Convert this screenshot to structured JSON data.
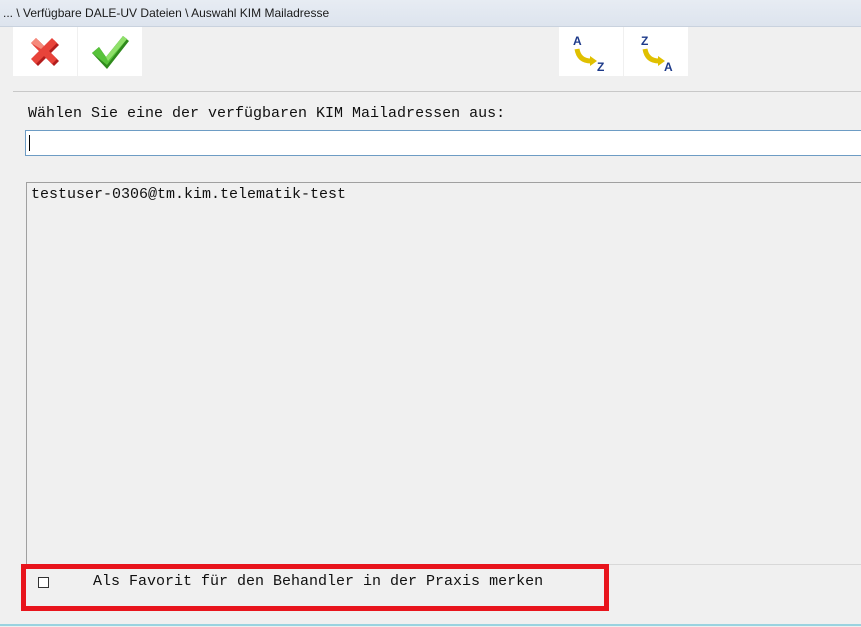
{
  "window": {
    "title": "... \\ Verfügbare DALE-UV Dateien \\ Auswahl KIM Mailadresse"
  },
  "toolbar": {
    "cancel": {
      "icon": "red-x-icon"
    },
    "ok": {
      "icon": "green-check-icon"
    },
    "sort_az": {
      "icon": "sort-a-z-icon",
      "from": "A",
      "to": "Z"
    },
    "sort_za": {
      "icon": "sort-z-a-icon",
      "from": "Z",
      "to": "A"
    }
  },
  "main": {
    "prompt": "Wählen Sie eine der verfügbaren KIM Mailadressen aus:",
    "input_value": "",
    "addresses": [
      "testuser-0306@tm.kim.telematik-test"
    ]
  },
  "favorite": {
    "label": "Als Favorit für den Behandler in der Praxis merken",
    "checked": false
  },
  "colors": {
    "highlight_border": "#e8141c",
    "input_border": "#6d9cc4"
  }
}
